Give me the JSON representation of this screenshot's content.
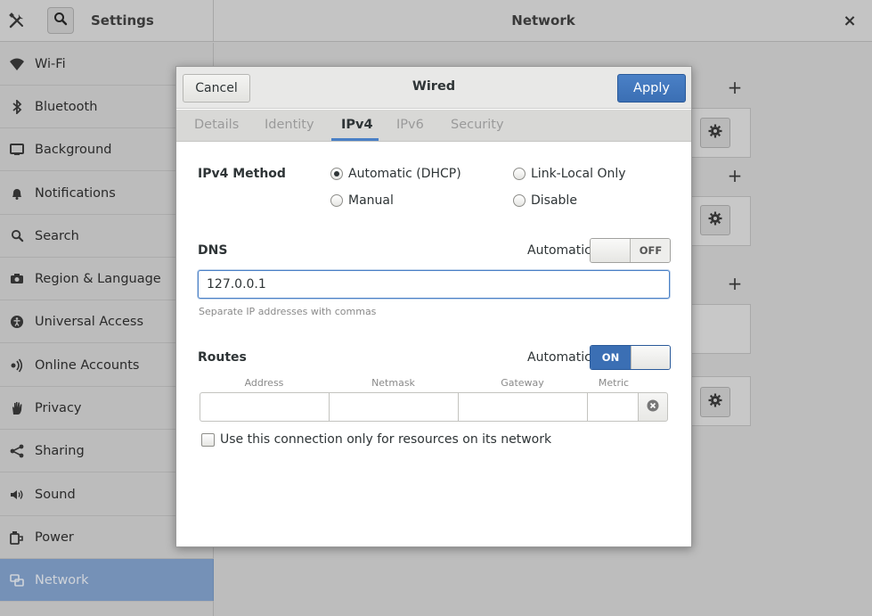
{
  "window": {
    "app_title": "Settings",
    "main_title": "Network",
    "close_symbol": "×"
  },
  "sidebar": {
    "items": [
      {
        "label": "Wi-Fi",
        "icon": "wifi-icon"
      },
      {
        "label": "Bluetooth",
        "icon": "bluetooth-icon"
      },
      {
        "label": "Background",
        "icon": "background-icon"
      },
      {
        "label": "Notifications",
        "icon": "bell-icon"
      },
      {
        "label": "Search",
        "icon": "search-icon"
      },
      {
        "label": "Region & Language",
        "icon": "camera-icon"
      },
      {
        "label": "Universal Access",
        "icon": "accessibility-icon"
      },
      {
        "label": "Online Accounts",
        "icon": "online-accounts-icon"
      },
      {
        "label": "Privacy",
        "icon": "hand-icon"
      },
      {
        "label": "Sharing",
        "icon": "share-icon"
      },
      {
        "label": "Sound",
        "icon": "speaker-icon"
      },
      {
        "label": "Power",
        "icon": "power-icon"
      },
      {
        "label": "Network",
        "icon": "network-icon",
        "active": true
      }
    ]
  },
  "background_content": {
    "add_symbol": "+"
  },
  "dialog": {
    "title": "Wired",
    "cancel_label": "Cancel",
    "apply_label": "Apply",
    "tabs": [
      "Details",
      "Identity",
      "IPv4",
      "IPv6",
      "Security"
    ],
    "active_tab": "IPv4",
    "ipv4_method": {
      "label": "IPv4 Method",
      "options": [
        {
          "label": "Automatic (DHCP)",
          "checked": true
        },
        {
          "label": "Link-Local Only",
          "checked": false
        },
        {
          "label": "Manual",
          "checked": false
        },
        {
          "label": "Disable",
          "checked": false
        }
      ]
    },
    "dns": {
      "label": "DNS",
      "automatic_label": "Automatic",
      "switch_state": "OFF",
      "value": "127.0.0.1",
      "hint": "Separate IP addresses with commas"
    },
    "routes": {
      "label": "Routes",
      "automatic_label": "Automatic",
      "switch_state": "ON",
      "columns": [
        "Address",
        "Netmask",
        "Gateway",
        "Metric"
      ]
    },
    "only_resources_label": "Use this connection only for resources on its network"
  },
  "colors": {
    "accent": "#3b6fb4",
    "dialog_bg": "#ffffff",
    "dimmed_bg": "#bdbdbd"
  }
}
